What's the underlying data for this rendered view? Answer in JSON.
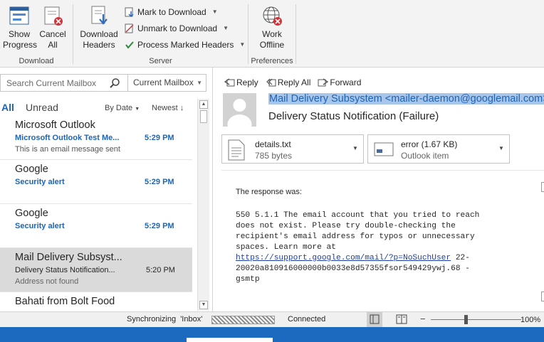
{
  "ribbon": {
    "show_progress": "Show\nProgress",
    "cancel_all": "Cancel\nAll",
    "download_group": "Download",
    "download_headers": "Download\nHeaders",
    "mark_to_download": "Mark to Download",
    "unmark_to_download": "Unmark to Download",
    "process_marked_headers": "Process Marked Headers",
    "server_group": "Server",
    "work_offline": "Work\nOffline",
    "preferences_group": "Preferences"
  },
  "search": {
    "placeholder": "Search Current Mailbox",
    "scope": "Current Mailbox"
  },
  "filter": {
    "all": "All",
    "unread": "Unread",
    "sort_by": "By Date",
    "sort_order": "Newest"
  },
  "messages": [
    {
      "from": "Microsoft Outlook",
      "subject": "Microsoft Outlook Test Me...",
      "time": "5:29 PM",
      "preview": "This is an email message sent"
    },
    {
      "from": "Google",
      "subject": "Security alert",
      "time": "5:29 PM",
      "preview": ""
    },
    {
      "from": "Google",
      "subject": "Security alert",
      "time": "5:29 PM",
      "preview": ""
    },
    {
      "from": "Mail Delivery Subsyst...",
      "subject": "Delivery Status Notification...",
      "time": "5:20 PM",
      "preview": "Address not found"
    },
    {
      "from": "Bahati from Bolt Food",
      "subject": "",
      "time": "",
      "preview": ""
    }
  ],
  "reading": {
    "reply": "Reply",
    "reply_all": "Reply All",
    "forward": "Forward",
    "sender": "Mail Delivery Subsystem <mailer-daemon@googlemail.com>",
    "subject": "Delivery Status Notification (Failure)",
    "attachments": [
      {
        "name": "details.txt",
        "size": "785 bytes"
      },
      {
        "name": "error (1.67 KB)",
        "size": "Outlook item"
      }
    ],
    "body_title": "The response was:",
    "body_line1": "550 5.1.1 The email account that you tried to reach",
    "body_line2": "does not exist. Please try double-checking the",
    "body_line3": "recipient's email address for typos or unnecessary",
    "body_line4": "spaces. Learn more at",
    "body_link": "https://support.google.com/mail/?p=NoSuchUser",
    "body_line5_tail": " 22-",
    "body_line6": "20020a810916000000b0033e8d57355fsor549429ywj.68 -",
    "body_line7": "gsmtp"
  },
  "status": {
    "sync": "Synchronizing  'Inbox'",
    "connection": "Connected",
    "zoom": "100%"
  }
}
